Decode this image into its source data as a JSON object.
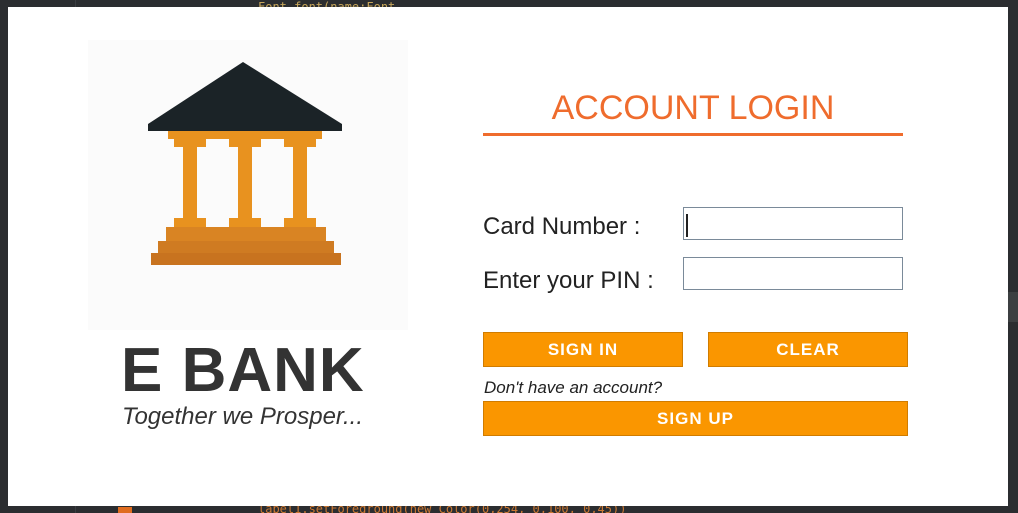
{
  "app": {
    "brand_name": "E BANK",
    "tagline": "Together we Prosper..."
  },
  "login": {
    "title": "ACCOUNT LOGIN",
    "card_label": "Card Number :",
    "card_value": "",
    "pin_label": "Enter your PIN :",
    "pin_value": "",
    "signin_label": "SIGN IN",
    "clear_label": "CLEAR",
    "no_account_text": "Don't have an account?",
    "signup_label": "SIGN UP"
  },
  "background_code": {
    "top_line": "Font.font(name:Font",
    "bottom_line": "label1.setForeground(new Color(0,254, 0,100, 0,45))"
  },
  "colors": {
    "accent": "#ef6c2d",
    "button": "#fa9600",
    "roof": "#1b2327",
    "column": "#e8921f",
    "base": "#c8731f"
  },
  "icons": {
    "logo": "bank-building-icon"
  }
}
